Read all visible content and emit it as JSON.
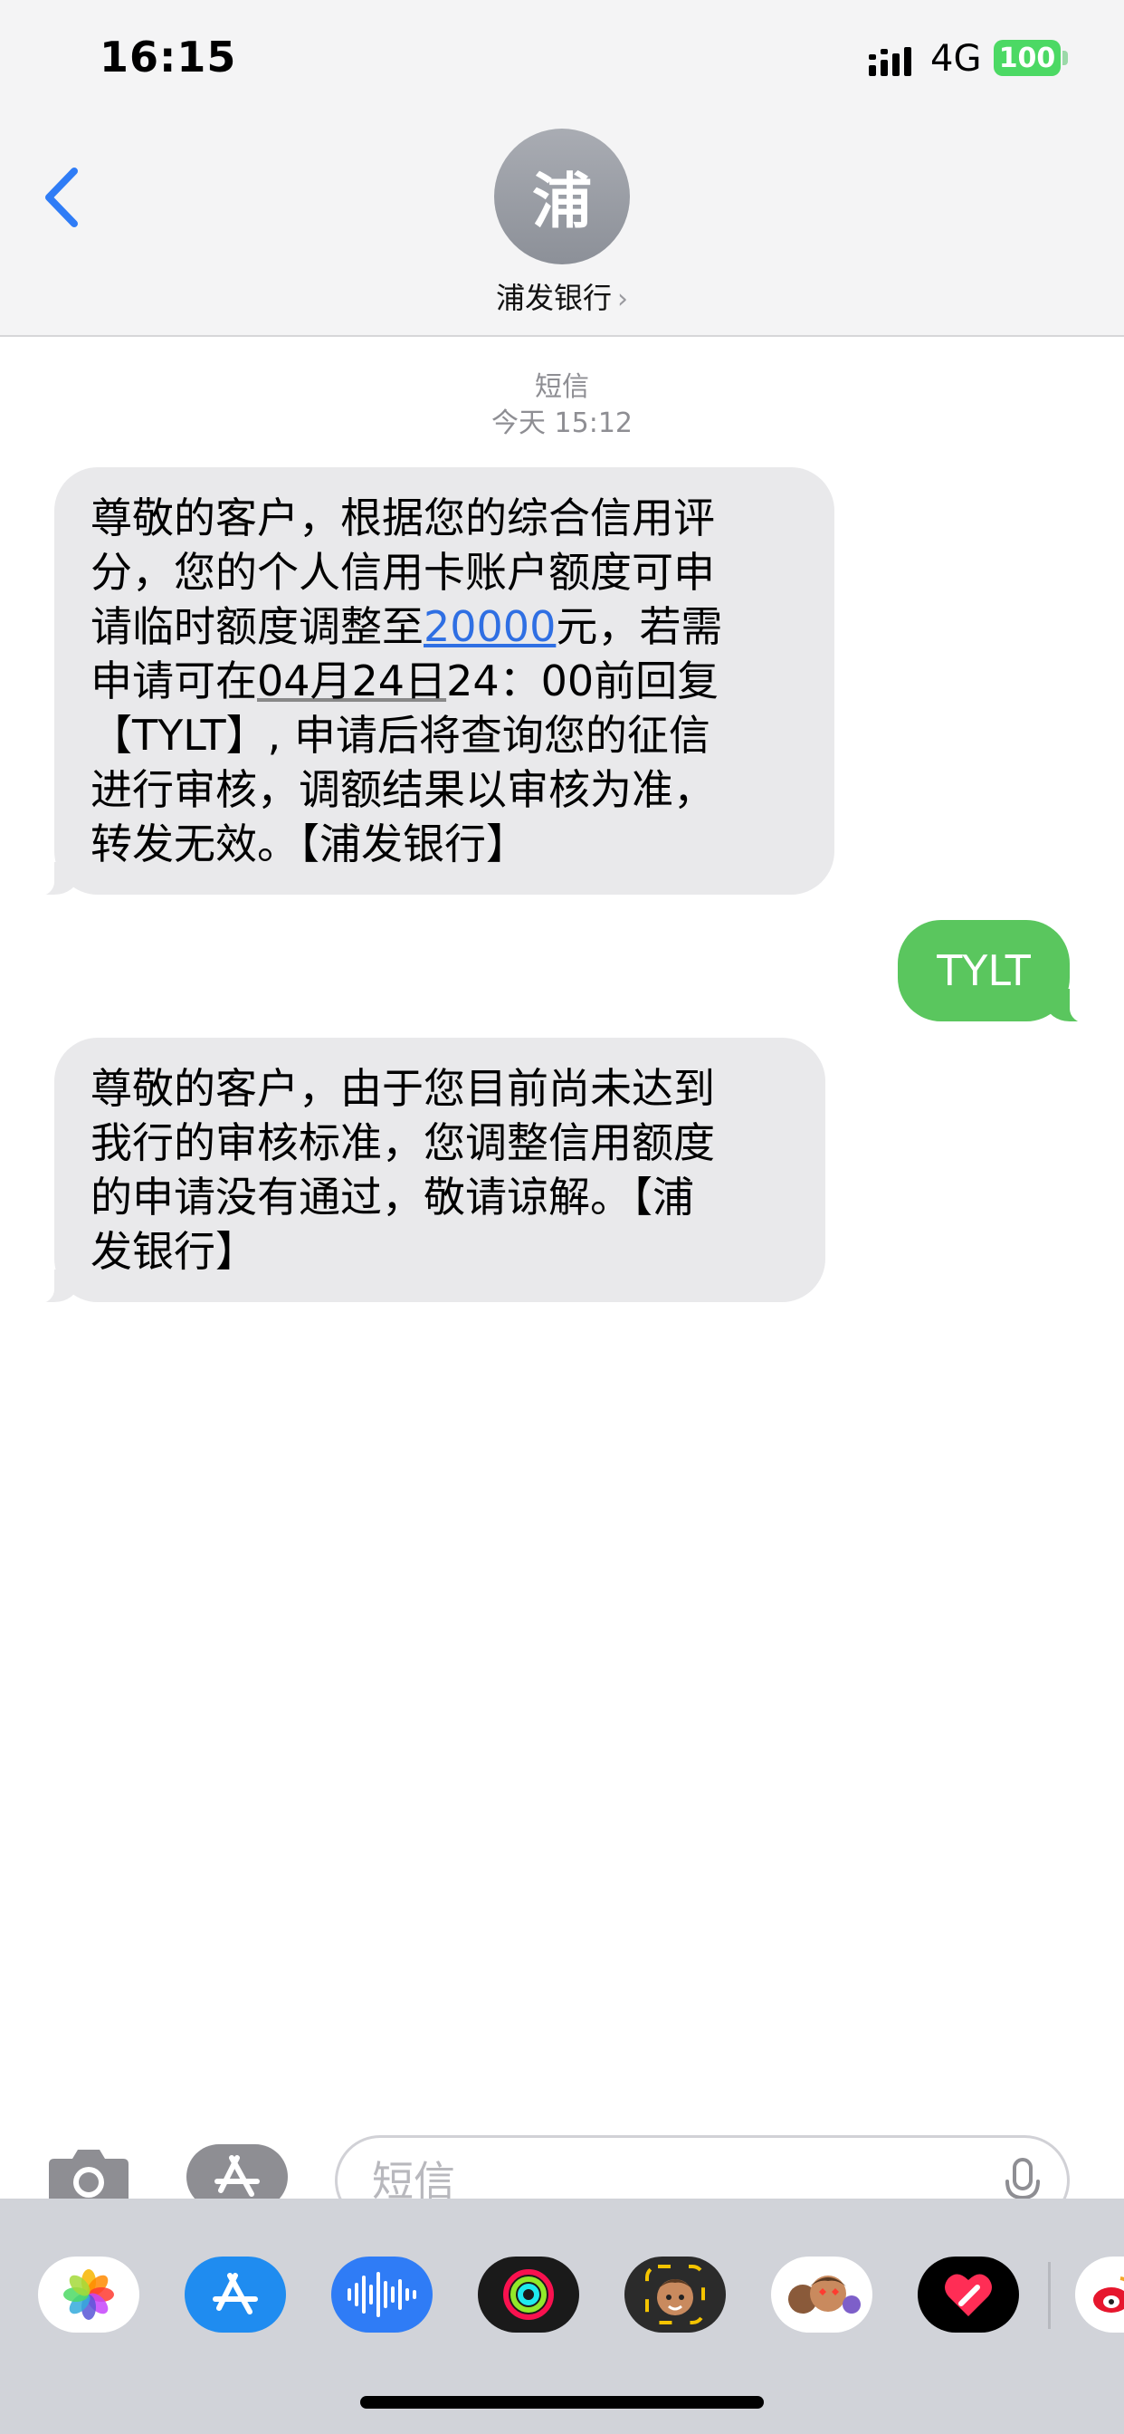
{
  "status_bar": {
    "time": "16:15",
    "network": "4G",
    "battery": "100"
  },
  "header": {
    "avatar_initial": "浦",
    "contact_name": "浦发银行",
    "chevron": "›"
  },
  "conversation": {
    "service_label": "短信",
    "timestamp": "今天 15:12",
    "messages": [
      {
        "direction": "incoming",
        "lines": [
          {
            "segments": [
              {
                "text": "尊敬的客户，根据您的综合信用评"
              }
            ]
          },
          {
            "segments": [
              {
                "text": "分，您的个人信用卡账户额度可申"
              }
            ]
          },
          {
            "segments": [
              {
                "text": "请临时额度调整至"
              },
              {
                "text": "20000",
                "style": "link"
              },
              {
                "text": "元，若需"
              }
            ]
          },
          {
            "segments": [
              {
                "text": "申请可在"
              },
              {
                "text": "04月24日",
                "style": "date"
              },
              {
                "text": "24：00前回复"
              }
            ]
          },
          {
            "segments": [
              {
                "text": "【TYLT】, 申请后将查询您的征信"
              }
            ]
          },
          {
            "segments": [
              {
                "text": "进行审核，调额结果以审核为准，"
              }
            ]
          },
          {
            "segments": [
              {
                "text": "转发无效。【浦发银行】"
              }
            ]
          }
        ]
      },
      {
        "direction": "outgoing",
        "text": "TYLT"
      },
      {
        "direction": "incoming",
        "lines": [
          {
            "segments": [
              {
                "text": "尊敬的客户，由于您目前尚未达到"
              }
            ]
          },
          {
            "segments": [
              {
                "text": "我行的审核标准，您调整信用额度"
              }
            ]
          },
          {
            "segments": [
              {
                "text": "的申请没有通过，敬请谅解。【浦"
              }
            ]
          },
          {
            "segments": [
              {
                "text": "发银行】"
              }
            ]
          }
        ]
      }
    ]
  },
  "composer": {
    "placeholder": "短信",
    "value": ""
  },
  "app_drawer": {
    "apps": [
      "photos-app-icon",
      "app-store-app-icon",
      "audio-message-app-icon",
      "activity-app-icon",
      "memoji-app-icon",
      "memoji-stickers-app-icon",
      "digital-touch-app-icon",
      "weibo-app-icon"
    ]
  },
  "colors": {
    "incoming_bubble": "#e9e9eb",
    "outgoing_bubble": "#5ac65e",
    "link": "#2f6fe3",
    "accent": "#2f7cf6",
    "battery": "#4cd964"
  }
}
